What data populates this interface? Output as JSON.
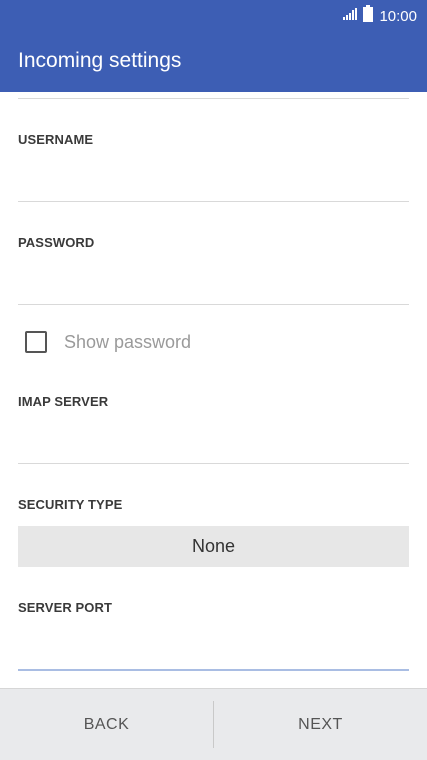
{
  "status_bar": {
    "time": "10:00",
    "icons": [
      "signal-icon",
      "battery-icon"
    ]
  },
  "header": {
    "title": "Incoming settings"
  },
  "form": {
    "username_label": "USERNAME",
    "username_value": "",
    "password_label": "PASSWORD",
    "password_value": "",
    "show_password_label": "Show password",
    "show_password_checked": false,
    "imap_server_label": "IMAP SERVER",
    "imap_server_value": "",
    "security_type_label": "SECURITY TYPE",
    "security_type_value": "None",
    "server_port_label": "SERVER PORT",
    "server_port_value": ""
  },
  "footer": {
    "back_label": "BACK",
    "next_label": "NEXT"
  },
  "colors": {
    "app_bar": "#3d5eb4",
    "footer": "#e9eaec",
    "select_bg": "#e7e7e7",
    "active_underline": "#a9bde3"
  }
}
